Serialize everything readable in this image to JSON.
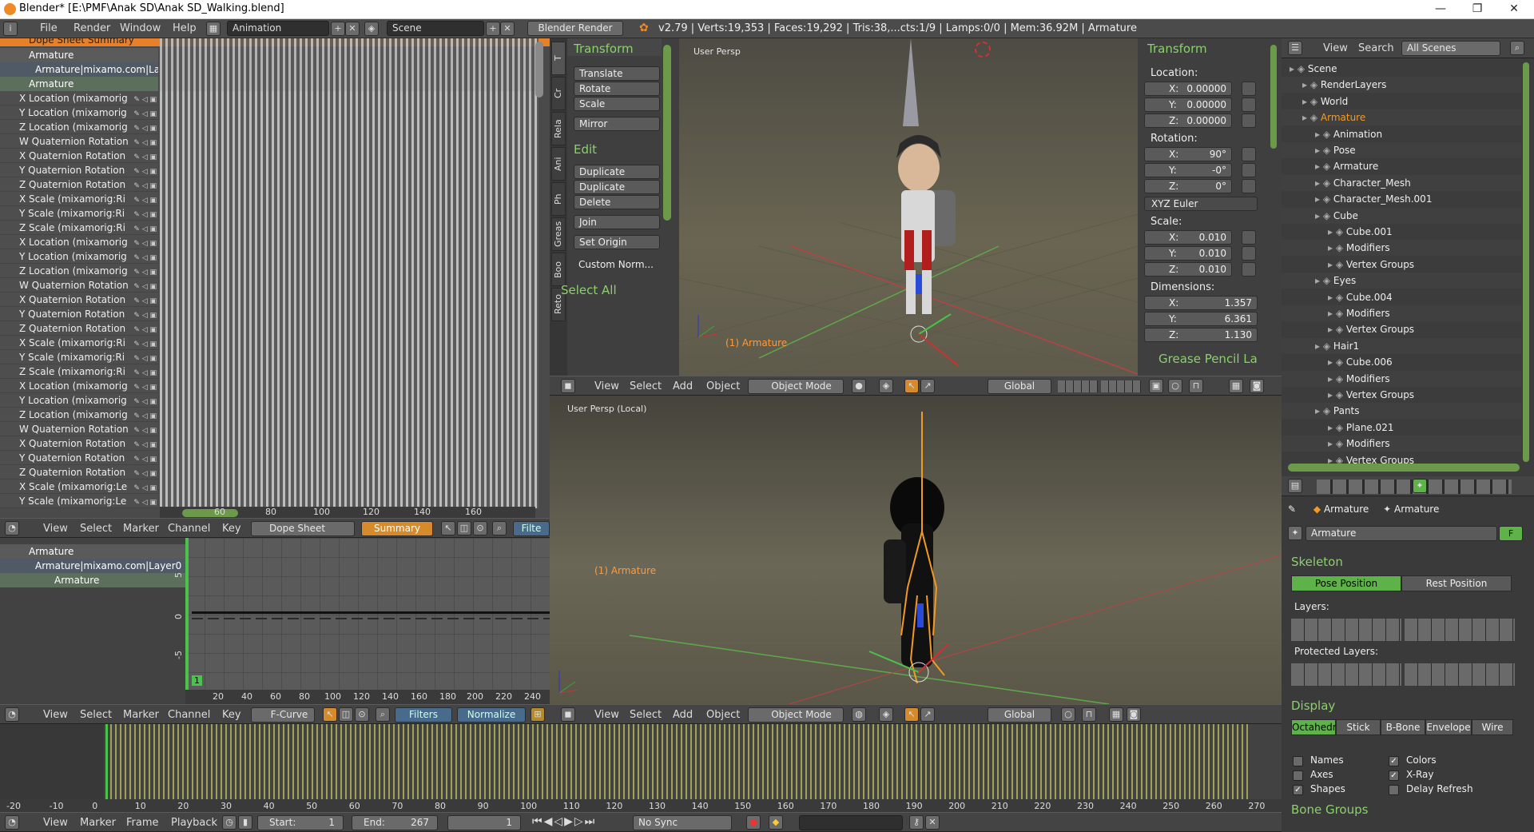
{
  "window": {
    "title": "Blender* [E:\\PMF\\Anak SD\\Anak SD_Walking.blend]",
    "minimize": "—",
    "maximize": "❐",
    "close": "✕"
  },
  "topbar": {
    "menus": [
      "File",
      "Render",
      "Window",
      "Help"
    ],
    "layout": "Animation",
    "scene": "Scene",
    "engine": "Blender Render",
    "stats": "v2.79 | Verts:19,353 | Faces:19,292 | Tris:38,...cts:1/9 | Lamps:0/0 | Mem:36.92M | Armature"
  },
  "dopesheet": {
    "summary": "Dope Sheet Summary",
    "object": "Armature",
    "action": "Armature|mixamo.com|Laye",
    "group": "Armature",
    "channels": [
      "X Location (mixamorig",
      "Y Location (mixamorig",
      "Z Location (mixamorig",
      "W Quaternion Rotation",
      "X Quaternion Rotation",
      "Y Quaternion Rotation",
      "Z Quaternion Rotation",
      "X Scale (mixamorig:Ri",
      "Y Scale (mixamorig:Ri",
      "Z Scale (mixamorig:Ri",
      "X Location (mixamorig",
      "Y Location (mixamorig",
      "Z Location (mixamorig",
      "W Quaternion Rotation",
      "X Quaternion Rotation",
      "Y Quaternion Rotation",
      "Z Quaternion Rotation",
      "X Scale (mixamorig:Ri",
      "Y Scale (mixamorig:Ri",
      "Z Scale (mixamorig:Ri",
      "X Location (mixamorig",
      "Y Location (mixamorig",
      "Z Location (mixamorig",
      "W Quaternion Rotation",
      "X Quaternion Rotation",
      "Y Quaternion Rotation",
      "Z Quaternion Rotation",
      "X Scale (mixamorig:Le",
      "Y Scale (mixamorig:Le"
    ],
    "ruler": [
      "60",
      "80",
      "100",
      "120",
      "140",
      "160"
    ],
    "header": {
      "menus": [
        "View",
        "Select",
        "Marker",
        "Channel",
        "Key"
      ],
      "mode": "Dope Sheet",
      "summary": "Summary",
      "filter": "Filte"
    }
  },
  "graph": {
    "object": "Armature",
    "action": "Armature|mixamo.com|Layer0",
    "group": "Armature",
    "yticks": [
      "5",
      "0",
      "-5"
    ],
    "frame": "1",
    "ruler": [
      "20",
      "40",
      "60",
      "80",
      "100",
      "120",
      "140",
      "160",
      "180",
      "200",
      "220",
      "240"
    ],
    "header": {
      "menus": [
        "View",
        "Select",
        "Marker",
        "Channel",
        "Key"
      ],
      "mode": "F-Curve",
      "filters": "Filters",
      "normalize": "Normalize"
    }
  },
  "toolshelf": {
    "tabs": [
      "T",
      "Cr",
      "Rela",
      "Ani",
      "Ph",
      "Greas",
      "Boo",
      "Reto"
    ],
    "transform_title": "Transform",
    "transform": [
      "Translate",
      "Rotate",
      "Scale"
    ],
    "mirror": "Mirror",
    "edit_title": "Edit",
    "edit": [
      "Duplicate",
      "Duplicate Linked",
      "Delete"
    ],
    "join": "Join",
    "set_origin": "Set Origin",
    "custom_norm": "Custom Norm...",
    "select_all": "Select All"
  },
  "viewport_top": {
    "label": "User Persp",
    "object_label": "(1) Armature",
    "header": {
      "menus": [
        "View",
        "Select",
        "Add",
        "Object"
      ],
      "mode": "Object Mode",
      "orientation": "Global"
    }
  },
  "viewport_bottom": {
    "label": "User Persp (Local)",
    "object_label": "(1) Armature",
    "header": {
      "menus": [
        "View",
        "Select",
        "Add",
        "Object"
      ],
      "mode": "Object Mode",
      "orientation": "Global"
    }
  },
  "npanel": {
    "title": "Transform",
    "location_label": "Location:",
    "location": [
      {
        "k": "X:",
        "v": "0.00000"
      },
      {
        "k": "Y:",
        "v": "0.00000"
      },
      {
        "k": "Z:",
        "v": "0.00000"
      }
    ],
    "rotation_label": "Rotation:",
    "rotation": [
      {
        "k": "X:",
        "v": "90°"
      },
      {
        "k": "Y:",
        "v": "-0°"
      },
      {
        "k": "Z:",
        "v": "0°"
      }
    ],
    "rotation_mode": "XYZ Euler",
    "scale_label": "Scale:",
    "scale": [
      {
        "k": "X:",
        "v": "0.010"
      },
      {
        "k": "Y:",
        "v": "0.010"
      },
      {
        "k": "Z:",
        "v": "0.010"
      }
    ],
    "dimensions_label": "Dimensions:",
    "dimensions": [
      {
        "k": "X:",
        "v": "1.357"
      },
      {
        "k": "Y:",
        "v": "6.361"
      },
      {
        "k": "Z:",
        "v": "1.130"
      }
    ],
    "grease_pencil": "Grease Pencil La"
  },
  "outliner": {
    "header": {
      "view": "View",
      "search": "Search",
      "filter": "All Scenes"
    },
    "rows": [
      "Scene",
      "RenderLayers",
      "World",
      "Armature",
      "Animation",
      "Pose",
      "Armature",
      "Character_Mesh",
      "Character_Mesh.001",
      "Cube",
      "Cube.001",
      "Modifiers",
      "Vertex Groups",
      "Eyes",
      "Cube.004",
      "Modifiers",
      "Vertex Groups",
      "Hair1",
      "Cube.006",
      "Modifiers",
      "Vertex Groups",
      "Pants",
      "Plane.021",
      "Modifiers",
      "Vertex Groups"
    ]
  },
  "properties": {
    "breadcrumb": [
      "Armature",
      "Armature"
    ],
    "datablock": "Armature",
    "fake_user": "F",
    "skeleton_title": "Skeleton",
    "pose_position": "Pose Position",
    "rest_position": "Rest Position",
    "layers_label": "Layers:",
    "protected_label": "Protected Layers:",
    "display_title": "Display",
    "display_modes": [
      "Octahedr",
      "Stick",
      "B-Bone",
      "Envelope",
      "Wire"
    ],
    "options": [
      {
        "label": "Names",
        "checked": false
      },
      {
        "label": "Colors",
        "checked": true
      },
      {
        "label": "Axes",
        "checked": false
      },
      {
        "label": "X-Ray",
        "checked": true
      },
      {
        "label": "Shapes",
        "checked": true
      },
      {
        "label": "Delay Refresh",
        "checked": false
      }
    ],
    "bone_groups": "Bone Groups"
  },
  "timeline": {
    "ruler": [
      "-20",
      "-10",
      "0",
      "10",
      "20",
      "30",
      "40",
      "50",
      "60",
      "70",
      "80",
      "90",
      "100",
      "110",
      "120",
      "130",
      "140",
      "150",
      "160",
      "170",
      "180",
      "190",
      "200",
      "210",
      "220",
      "230",
      "240",
      "250",
      "260",
      "270"
    ],
    "header": {
      "menus": [
        "View",
        "Marker",
        "Frame",
        "Playback"
      ],
      "start_label": "Start:",
      "start": "1",
      "end_label": "End:",
      "end": "267",
      "current": "1",
      "sync": "No Sync"
    }
  },
  "colors": {
    "accent": "#5fb24a",
    "title_green": "#8bd16b",
    "armature_orange": "#f39a20",
    "selected_orange": "#e88b1a"
  }
}
